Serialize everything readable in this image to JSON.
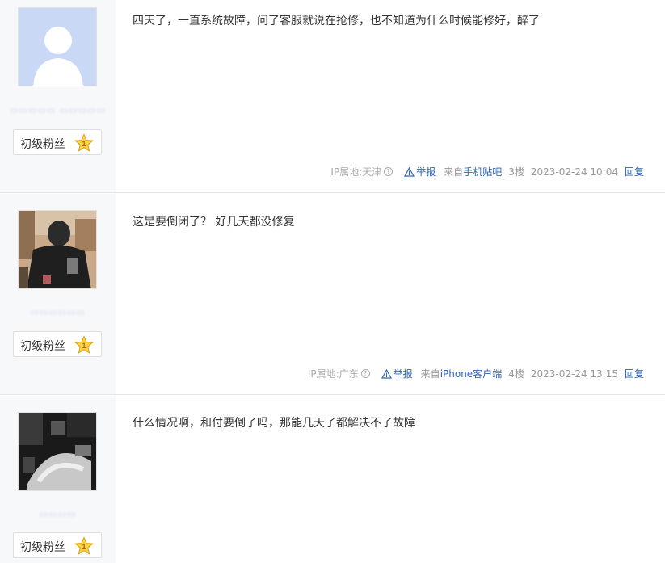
{
  "posts": [
    {
      "username": "▭▭▭▭▭ ▭▭▭▭▭",
      "badge_label": "初级粉丝",
      "badge_level": "1",
      "avatar_icon": "default-avatar-icon",
      "content": "四天了，一直系统故障，问了客服就说在抢修，也不知道为什么时候能修好，醉了",
      "ip_location": "IP属地:天津",
      "report_label": "举报",
      "from_prefix": "来自",
      "client": "手机贴吧",
      "floor": "3楼",
      "datetime": "2023-02-24 10:04",
      "reply_label": "回复"
    },
    {
      "username": "▭▭▭▭▭▭",
      "badge_label": "初级粉丝",
      "badge_level": "1",
      "avatar_icon": "user-photo-icon",
      "content": "这是要倒闭了？ 好几天都没修复",
      "ip_location": "IP属地:广东",
      "report_label": "举报",
      "from_prefix": "来自",
      "client": "iPhone客户端",
      "floor": "4楼",
      "datetime": "2023-02-24 13:15",
      "reply_label": "回复"
    },
    {
      "username": "▭▭▭▭",
      "badge_label": "初级粉丝",
      "badge_level": "1",
      "avatar_icon": "user-photo-icon",
      "content": "什么情况啊，和付要倒了吗，那能几天了都解决不了故障"
    }
  ],
  "colors": {
    "link": "#2d64b3",
    "sidebar_bg": "#f7f8fa",
    "star": "#f5b800"
  }
}
